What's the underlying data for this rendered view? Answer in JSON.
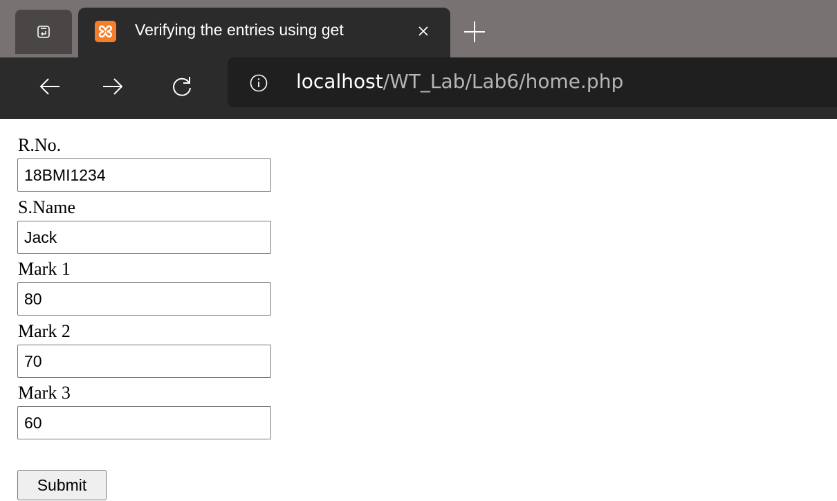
{
  "browser": {
    "tab_title": "Verifying the entries using get",
    "favicon": "xampp-icon",
    "url_host": "localhost",
    "url_path": "/WT_Lab/Lab6/home.php"
  },
  "form": {
    "fields": [
      {
        "label": "R.No.",
        "value": "18BMI1234"
      },
      {
        "label": "S.Name",
        "value": "Jack"
      },
      {
        "label": "Mark 1",
        "value": "80"
      },
      {
        "label": "Mark 2",
        "value": "70"
      },
      {
        "label": "Mark 3",
        "value": "60"
      }
    ],
    "submit_label": "Submit"
  }
}
